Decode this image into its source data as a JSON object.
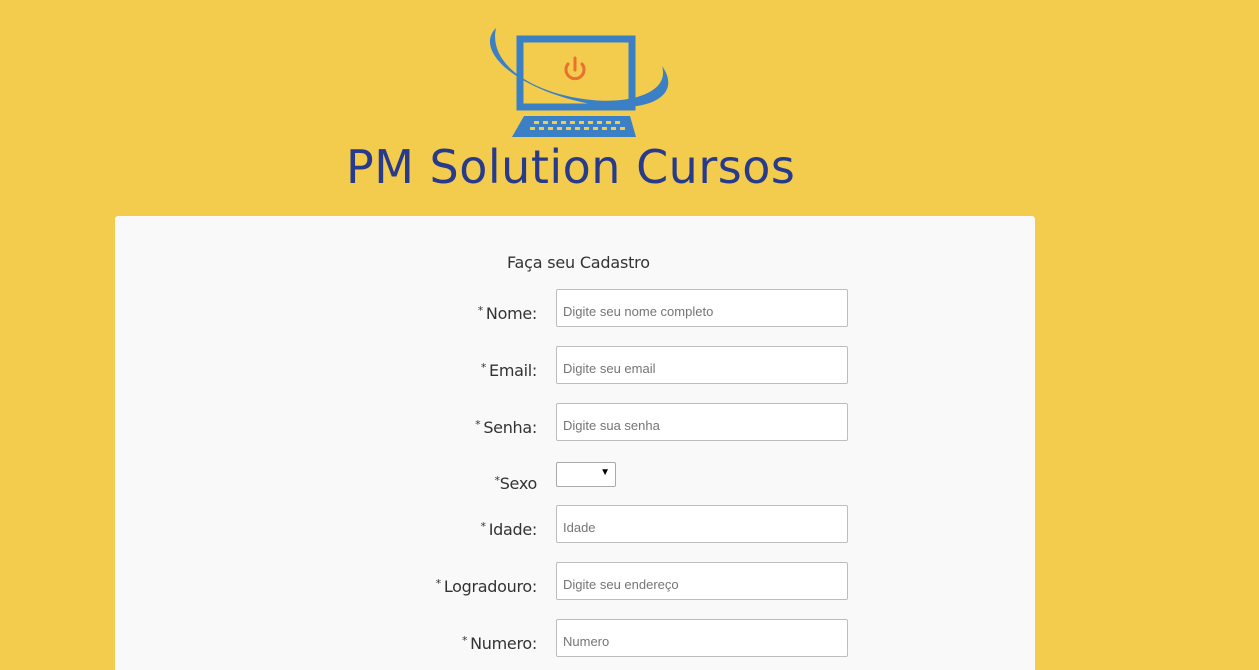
{
  "brand": {
    "name": "PM Solution Cursos",
    "colors": {
      "background": "#f3cc4d",
      "logo_blue": "#3b7fc4",
      "brand_text": "#283a8b",
      "power_icon": "#e8712e"
    },
    "logo_icon": "computer-monitor-power-icon"
  },
  "form": {
    "title": "Faça seu Cadastro",
    "fields": [
      {
        "star": "*",
        "label": "Nome:",
        "placeholder": "Digite seu nome completo"
      },
      {
        "star": "*",
        "label": "Email:",
        "placeholder": "Digite seu email"
      },
      {
        "star": "*",
        "label": "Senha:",
        "placeholder": "Digite sua senha"
      },
      {
        "star": "*",
        "label": "Sexo",
        "value": ""
      },
      {
        "star": "*",
        "label": "Idade:",
        "placeholder": "Idade"
      },
      {
        "star": "*",
        "label": "Logradouro:",
        "placeholder": "Digite seu endereço"
      },
      {
        "star": "*",
        "label": "Numero:",
        "placeholder": "Numero"
      }
    ]
  }
}
